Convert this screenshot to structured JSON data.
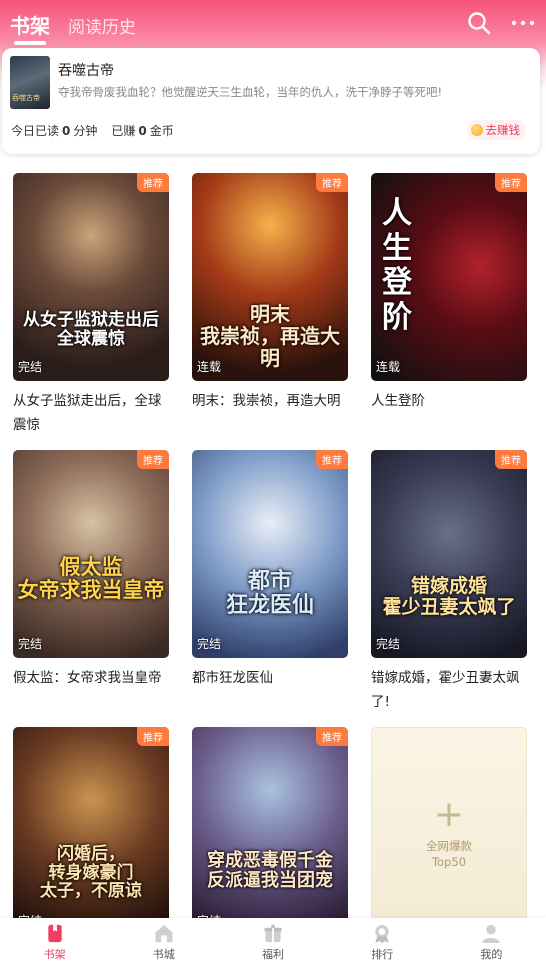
{
  "header": {
    "tabs": [
      {
        "label": "书架",
        "active": true
      },
      {
        "label": "阅读历史",
        "active": false
      }
    ],
    "icons": [
      "search-icon",
      "more-icon"
    ],
    "accent_color": "#f6537a"
  },
  "recent": {
    "cover_text": "吞噬古帝",
    "title": "吞噬古帝",
    "desc": "夺我帝骨废我血轮？他觉醒逆天三生血轮，当年的仇人，洗干净脖子等死吧!",
    "today_read_prefix": "今日已读",
    "today_read_value": "0",
    "today_read_unit": "分钟",
    "earned_prefix": "已赚",
    "earned_value": "0",
    "earned_unit": "金币",
    "earn_button": "去赚钱"
  },
  "books": [
    {
      "title": "从女子监狱走出后，全球震惊",
      "cover_text": "从女子监狱走出后\n全球震惊",
      "badge": "推荐",
      "status": "完结"
    },
    {
      "title": "明末：我崇祯，再造大明",
      "cover_text": "明末\n我崇祯，再造大明",
      "badge": "推荐",
      "status": "连载"
    },
    {
      "title": "人生登阶",
      "cover_text": "人生登阶",
      "badge": "推荐",
      "status": "连载"
    },
    {
      "title": "假太监：女帝求我当皇帝",
      "cover_text": "假太监\n女帝求我当皇帝",
      "badge": "推荐",
      "status": "完结"
    },
    {
      "title": "都市狂龙医仙",
      "cover_text": "都市\n狂龙医仙",
      "badge": "推荐",
      "status": "完结"
    },
    {
      "title": "错嫁成婚，霍少丑妻太飒了!",
      "cover_text": "错嫁成婚\n霍少丑妻太飒了",
      "badge": "推荐",
      "status": "完结"
    },
    {
      "title": "",
      "cover_text": "闪婚后，\n转身嫁豪门\n太子，不原谅",
      "badge": "推荐",
      "status": "完结"
    },
    {
      "title": "",
      "cover_text": "穿成恶毒假千金\n反派逼我当团宠",
      "badge": "推荐",
      "status": "完结"
    }
  ],
  "add_card": {
    "plus": "+",
    "line1": "全网爆款",
    "line2": "Top50"
  },
  "nav": [
    {
      "label": "书架",
      "icon": "bookshelf-icon",
      "active": true
    },
    {
      "label": "书城",
      "icon": "store-icon",
      "active": false
    },
    {
      "label": "福利",
      "icon": "gift-icon",
      "active": false
    },
    {
      "label": "排行",
      "icon": "ranking-icon",
      "active": false
    },
    {
      "label": "我的",
      "icon": "profile-icon",
      "active": false
    }
  ]
}
